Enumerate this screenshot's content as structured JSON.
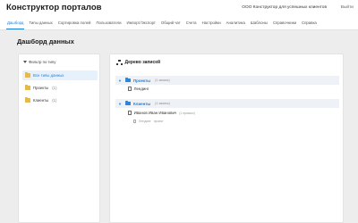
{
  "app": {
    "title": "Конструктор порталов",
    "org_name": "ООО Конструктор для успешных клиентов",
    "logout_label": "Выйти"
  },
  "nav": {
    "items": [
      {
        "label": "Дашборд",
        "active": true
      },
      {
        "label": "Типы данных",
        "active": false
      },
      {
        "label": "Сортировка полей",
        "active": false
      },
      {
        "label": "Пользователи",
        "active": false
      },
      {
        "label": "Импорт/Экспорт",
        "active": false
      },
      {
        "label": "Общий чат",
        "active": false
      },
      {
        "label": "Счета",
        "active": false
      },
      {
        "label": "Настройки",
        "active": false
      },
      {
        "label": "Аналитика",
        "active": false
      },
      {
        "label": "Шаблоны",
        "active": false
      },
      {
        "label": "Справочники",
        "active": false
      },
      {
        "label": "Справка",
        "active": false
      }
    ]
  },
  "page": {
    "title": "Дашборд данных"
  },
  "filter": {
    "heading": "Фильтр по типу",
    "heading_icon": "funnel-icon",
    "items": [
      {
        "label": "Все типы данных",
        "count": "",
        "icon": "folder-icon",
        "active": true
      },
      {
        "label": "Проекты",
        "count": "(1)",
        "icon": "folder-icon",
        "active": false
      },
      {
        "label": "Клиенты",
        "count": "(1)",
        "icon": "folder-icon",
        "active": false
      }
    ]
  },
  "tree": {
    "heading": "Дерево записей",
    "heading_icon": "sitemap-icon",
    "groups": [
      {
        "label": "Проекты",
        "count": "(1 запись)",
        "records": [
          {
            "label": "Лендинг",
            "sub": "",
            "children": []
          }
        ]
      },
      {
        "label": "Клиенты",
        "count": "(1 запись)",
        "records": [
          {
            "label": "Иванов Иван Иванович",
            "sub": "(1 прямых)",
            "children": [
              {
                "label": "Лендинг",
                "sub": "проект"
              }
            ]
          }
        ]
      }
    ]
  },
  "colors": {
    "accent": "#1e7fd6",
    "folder_yellow": "#e5b94a",
    "folder_blue": "#2d86d8",
    "background": "#ededed"
  }
}
